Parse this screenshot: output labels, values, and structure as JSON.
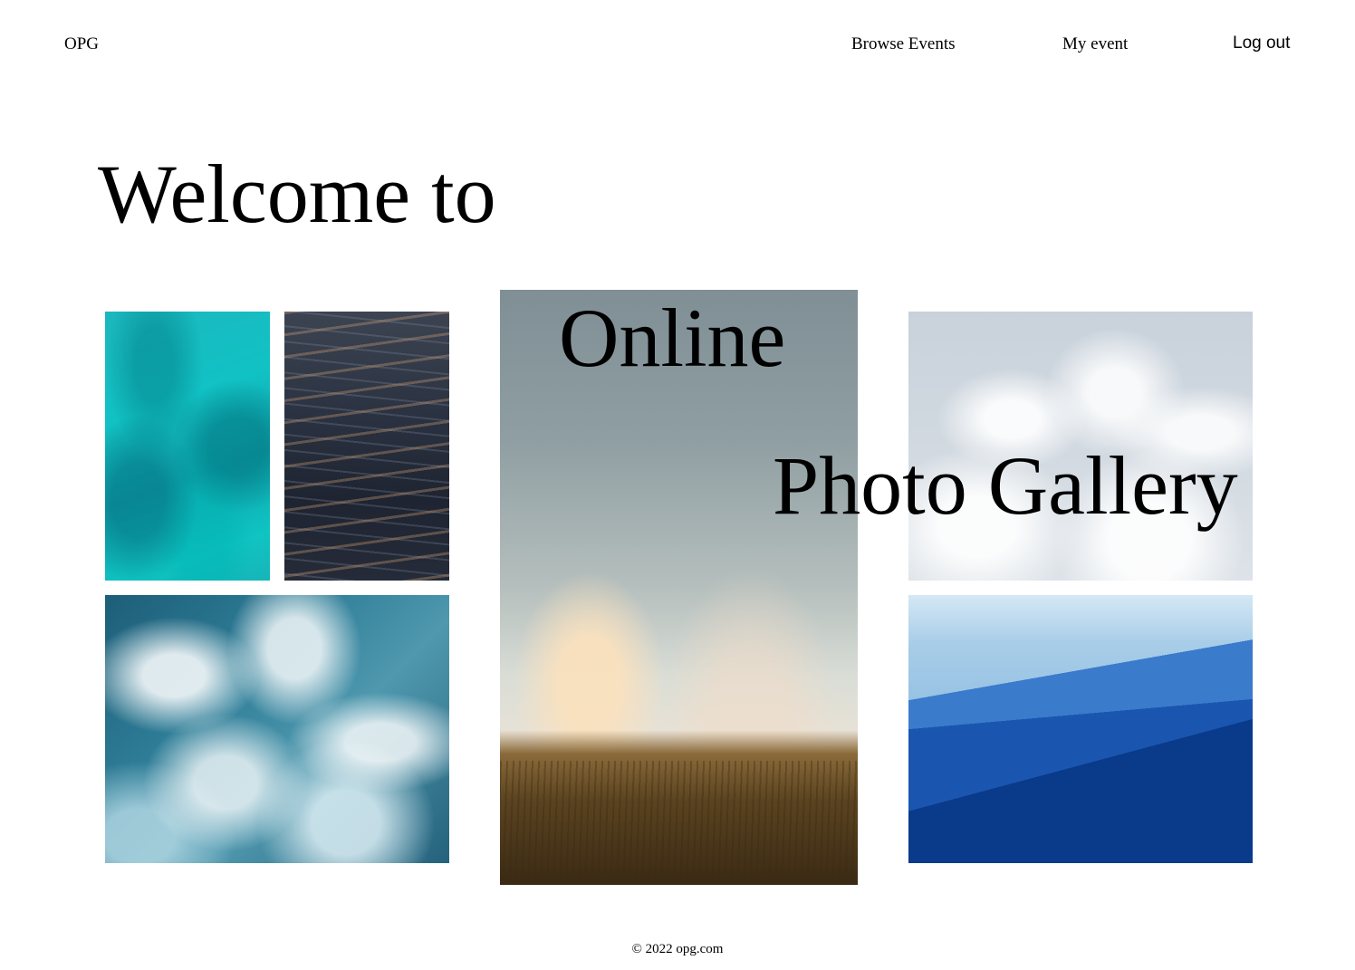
{
  "header": {
    "logo": "OPG",
    "nav": {
      "browse_events": "Browse Events",
      "my_event": "My event",
      "logout": "Log out"
    }
  },
  "hero": {
    "line1": "Welcome to",
    "line2": "Online",
    "line3": "Photo Gallery"
  },
  "footer": {
    "copyright": "© 2022 opg.com"
  }
}
